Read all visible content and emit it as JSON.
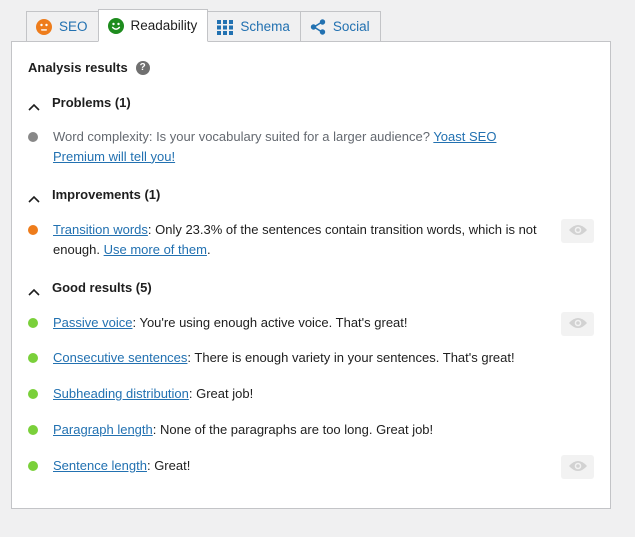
{
  "tabs": [
    {
      "label": "SEO",
      "icon": "neutral-face-icon",
      "color": "#ee7c1b"
    },
    {
      "label": "Readability",
      "icon": "smiley-face-icon",
      "color": "#1e8c1e"
    },
    {
      "label": "Schema",
      "icon": "grid-icon",
      "color": "#2271b1"
    },
    {
      "label": "Social",
      "icon": "share-icon",
      "color": "#2271b1"
    }
  ],
  "analysis": {
    "title": "Analysis results",
    "help_symbol": "?"
  },
  "sections": {
    "problems": {
      "label": "Problems (1)"
    },
    "improvements": {
      "label": "Improvements (1)"
    },
    "good": {
      "label": "Good results (5)"
    }
  },
  "colors": {
    "problem": "#888888",
    "improvement": "#ee7c1b",
    "good": "#7ad03a",
    "link": "#2271b1"
  },
  "problems": [
    {
      "text": "Word complexity: Is your vocabulary suited for a larger audience? ",
      "link": "Yoast SEO Premium will tell you!",
      "suffix": ""
    }
  ],
  "improvements": [
    {
      "link": "Transition words",
      "text": ": Only 23.3% of the sentences contain transition words, which is not enough. ",
      "link2": "Use more of them",
      "suffix": "."
    }
  ],
  "good_results": [
    {
      "link": "Passive voice",
      "text": ": You're using enough active voice. That's great!"
    },
    {
      "link": "Consecutive sentences",
      "text": ": There is enough variety in your sentences. That's great!"
    },
    {
      "link": "Subheading distribution",
      "text": ": Great job!"
    },
    {
      "link": "Paragraph length",
      "text": ": None of the paragraphs are too long. Great job!"
    },
    {
      "link": "Sentence length",
      "text": ": Great!"
    }
  ]
}
